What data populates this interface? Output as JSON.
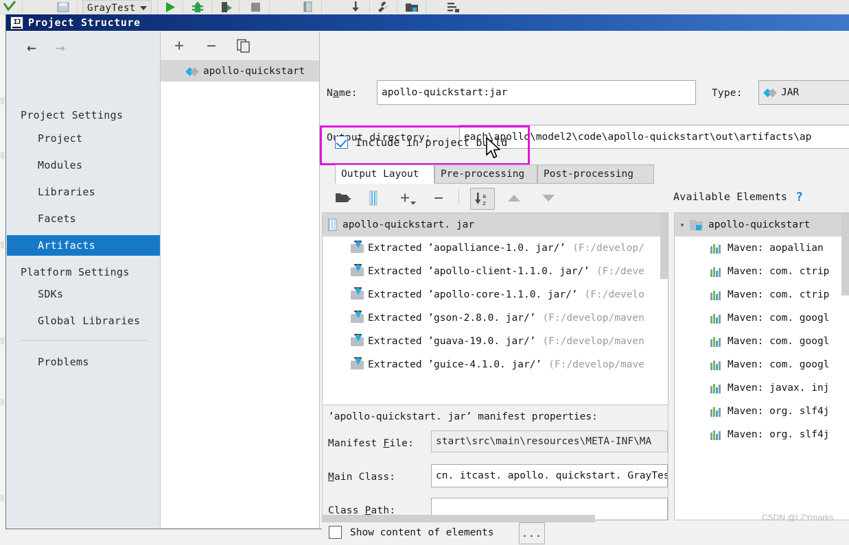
{
  "ide_toolbar": {
    "run_config": "GrayTest",
    "icons": [
      "checkmark-icon",
      "save-icon",
      "run-icon",
      "build-icon",
      "rerun-icon",
      "stop-icon",
      "bookmark-icon",
      "download-icon",
      "wrench-icon",
      "folder-icon",
      "structure-icon"
    ]
  },
  "dialog": {
    "title": "Project Structure",
    "badge": "IJ"
  },
  "nav": {
    "back_arrow": "←",
    "forward_arrow": "→",
    "groups": [
      {
        "label": "Project Settings",
        "items": [
          {
            "label": "Project",
            "selected": false
          },
          {
            "label": "Modules",
            "selected": false
          },
          {
            "label": "Libraries",
            "selected": false
          },
          {
            "label": "Facets",
            "selected": false
          },
          {
            "label": "Artifacts",
            "selected": true
          }
        ]
      },
      {
        "label": "Platform Settings",
        "items": [
          {
            "label": "SDKs",
            "selected": false
          },
          {
            "label": "Global Libraries",
            "selected": false
          }
        ]
      }
    ],
    "problems": "Problems"
  },
  "artifact_list": {
    "toolbar": {
      "add": "+",
      "remove": "−",
      "copy": "copy-icon"
    },
    "items": [
      {
        "label": "apollo-quickstart",
        "selected": true
      }
    ]
  },
  "details": {
    "name_label": "Name:",
    "name_value": "apollo-quickstart:jar",
    "type_label": "Type:",
    "type_value": "JAR",
    "output_dir_label": "Output directory:",
    "output_dir_value": "each\\apollo\\model2\\code\\apollo-quickstart\\out\\artifacts\\ap",
    "include_in_build_label": "Include in project build",
    "include_in_build_checked": true,
    "highlight_color": "#e312e3",
    "tabs": [
      {
        "label": "Output Layout",
        "active": true
      },
      {
        "label": "Pre-processing",
        "active": false
      },
      {
        "label": "Post-processing",
        "active": false
      }
    ]
  },
  "layout_toolbar": {
    "buttons": [
      "add-directory-icon",
      "add-archive-icon",
      "add-icon",
      "remove-icon",
      "sort-alphabetically-icon",
      "move-up-icon",
      "move-down-icon"
    ],
    "sort_label_top": "a",
    "sort_label_bottom": "z"
  },
  "output_layout_tree": {
    "root": "apollo-quickstart. jar",
    "children": [
      {
        "name": "Extracted ’aopalliance-1.0. jar/’",
        "path": "(F:/develop/"
      },
      {
        "name": "Extracted ’apollo-client-1.1.0. jar/’",
        "path": "(F:/deve"
      },
      {
        "name": "Extracted ’apollo-core-1.1.0. jar/’",
        "path": "(F:/develo"
      },
      {
        "name": "Extracted ’gson-2.8.0. jar/’",
        "path": "(F:/develop/maven"
      },
      {
        "name": "Extracted ’guava-19.0. jar/’",
        "path": "(F:/develop/maven"
      },
      {
        "name": "Extracted ’guice-4.1.0. jar/’",
        "path": "(F:/develop/mave"
      }
    ]
  },
  "manifest": {
    "heading": "’apollo-quickstart. jar’ manifest properties:",
    "file_label_pre": "Manifest ",
    "file_label_key": "F",
    "file_label_post": "ile:",
    "file_value": "start\\src\\main\\resources\\META-INF\\MA",
    "main_class_label_key": "M",
    "main_class_label_post": "ain Class:",
    "main_class_value": "cn. itcast. apollo. quickstart. GrayTes",
    "class_path_label_pre": "Class ",
    "class_path_label_key": "P",
    "class_path_label_post": "ath:",
    "class_path_value": ""
  },
  "available_elements": {
    "heading": "Available Elements",
    "help": "?",
    "root": "apollo-quickstart",
    "items": [
      {
        "label": "Maven: aopallian"
      },
      {
        "label": "Maven: com. ctrip"
      },
      {
        "label": "Maven: com. ctrip"
      },
      {
        "label": "Maven: com. googl"
      },
      {
        "label": "Maven: com. googl"
      },
      {
        "label": "Maven: com. googl"
      },
      {
        "label": "Maven: javax. inj"
      },
      {
        "label": "Maven: org. slf4j"
      },
      {
        "label": "Maven: org. slf4j"
      }
    ]
  },
  "bottom": {
    "show_content_label": "Show content of elements",
    "show_content_checked": false,
    "dots_button": "..."
  },
  "watermark": "CSDN @LZYmarks"
}
